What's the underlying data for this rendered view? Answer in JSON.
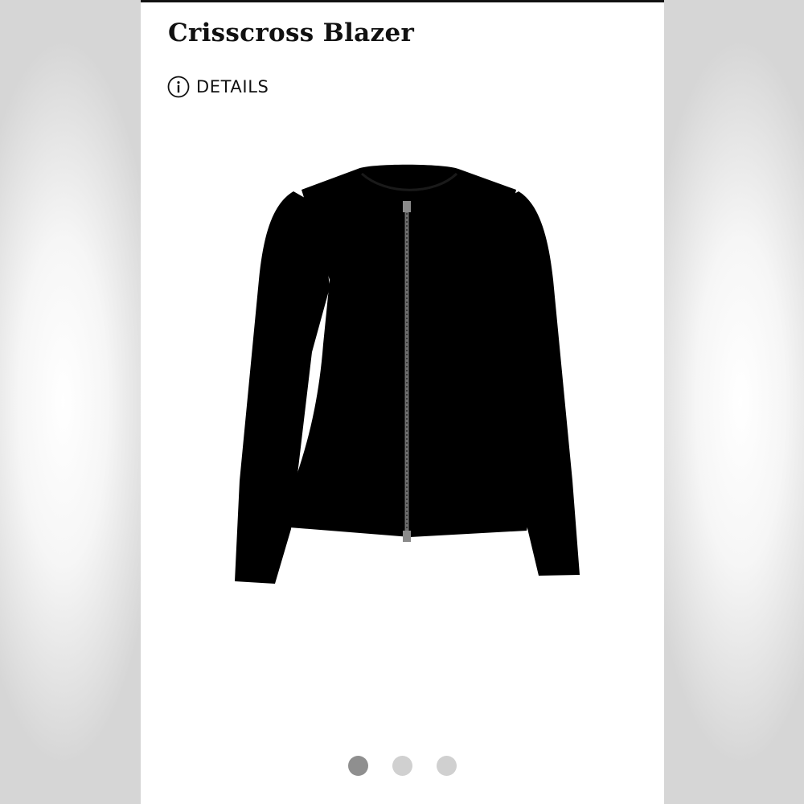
{
  "product": {
    "title": "Crisscross Blazer",
    "details_label": "DETAILS",
    "info_icon": "info-circle-icon"
  },
  "carousel": {
    "total": 3,
    "active_index": 0
  },
  "colors": {
    "card_background": "#ffffff",
    "text": "#111111",
    "dot_active": "#8f8f8f",
    "dot_inactive": "#d0d0d0"
  }
}
